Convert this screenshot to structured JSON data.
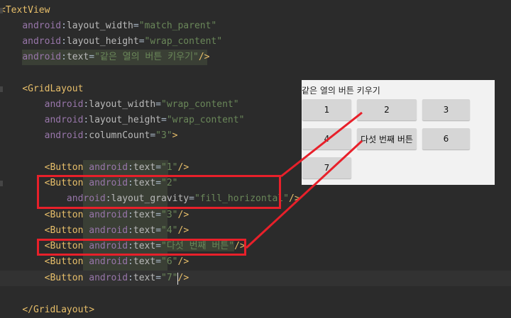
{
  "code": {
    "tv_open": "<TextView",
    "tv_attrs": [
      {
        "ns": "android",
        "name": "layout_width",
        "value": "\"match_parent\""
      },
      {
        "ns": "android",
        "name": "layout_height",
        "value": "\"wrap_content\""
      },
      {
        "ns": "android",
        "name": "text",
        "value": "\"같은 열의 버튼 키우기\"",
        "close": "/>"
      }
    ],
    "gl_open": "<GridLayout",
    "gl_attrs": [
      {
        "ns": "android",
        "name": "layout_width",
        "value": "\"wrap_content\""
      },
      {
        "ns": "android",
        "name": "layout_height",
        "value": "\"wrap_content\""
      },
      {
        "ns": "android",
        "name": "columnCount",
        "value": "\"3\"",
        "close": ">"
      }
    ],
    "button_tag": "<Button",
    "button_ns": "android",
    "button_attr": "text",
    "button_values": [
      "\"1\"",
      "\"2\"",
      "\"3\"",
      "\"4\"",
      "\"다섯 번째 버튼\"",
      "\"6\"",
      "\"7\""
    ],
    "gravity": {
      "ns": "android",
      "name": "layout_gravity",
      "value": "\"fill_horizontal\""
    },
    "self_close": "/>",
    "gl_close": "</GridLayout>"
  },
  "preview": {
    "title": "같은 열의 버튼 키우기",
    "buttons": [
      "1",
      "2",
      "3",
      "4",
      "다섯 번째 버튼",
      "6",
      "7"
    ]
  },
  "colors": {
    "highlight": "#e8202a",
    "background": "#2b2b2b",
    "preview_bg": "#f2f2f2"
  }
}
